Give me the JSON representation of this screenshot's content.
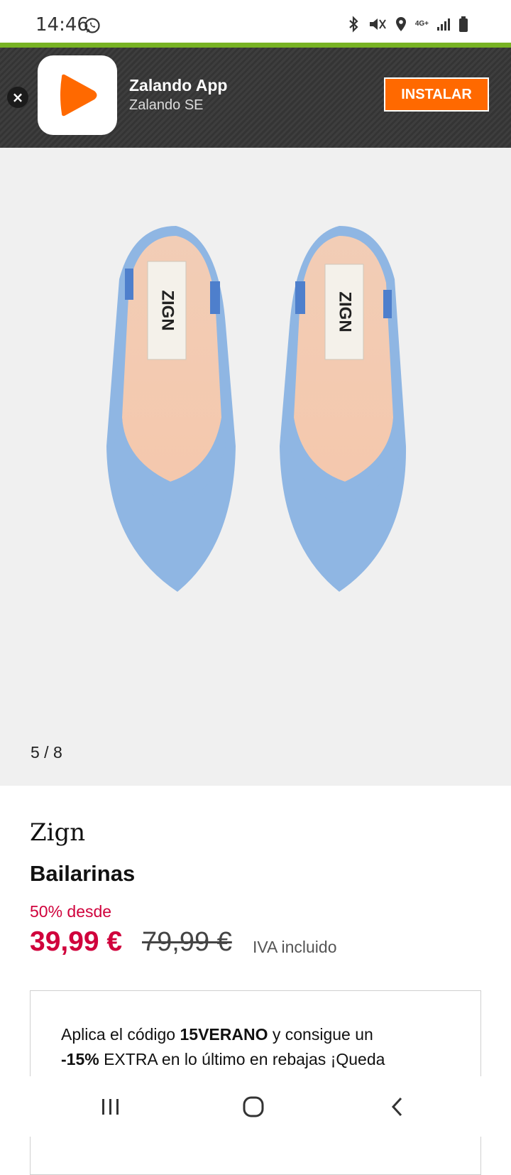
{
  "status_bar": {
    "time": "14:46",
    "network": "4G+"
  },
  "banner": {
    "app_name": "Zalando App",
    "developer": "Zalando SE",
    "install_label": "INSTALAR",
    "close_label": "×",
    "accent_color": "#ff6900"
  },
  "gallery": {
    "counter": "5 / 8",
    "insole_label_left": "ZIGN",
    "insole_label_right": "ZIGN"
  },
  "product": {
    "brand": "Zign",
    "name": "Bailarinas",
    "discount_label": "50% desde",
    "price": "39,99 €",
    "original_price": "79,99 €",
    "vat_label": "IVA incluido",
    "price_color": "#d0023c"
  },
  "promo": {
    "t1": "Aplica el código ",
    "code": "15VERANO",
    "t2": " y consigue un ",
    "extra": "-15%",
    "t3": " EXTRA en lo último en rebajas ¡Queda"
  }
}
